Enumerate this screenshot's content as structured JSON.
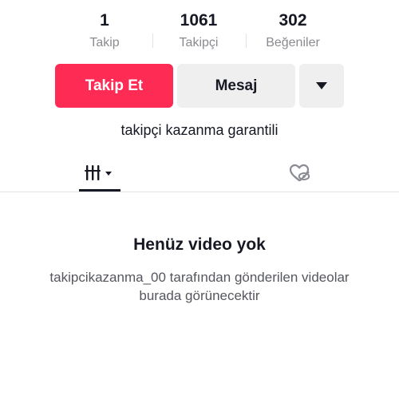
{
  "stats": {
    "following": {
      "value": "1",
      "label": "Takip"
    },
    "followers": {
      "value": "1061",
      "label": "Takipçi"
    },
    "likes": {
      "value": "302",
      "label": "Beğeniler"
    }
  },
  "actions": {
    "follow_label": "Takip Et",
    "message_label": "Mesaj",
    "more_icon": "caret-down-icon"
  },
  "bio": "takipçi kazanma garantili",
  "tabs": [
    {
      "name": "videos",
      "icon": "grid-lines-icon",
      "selected": true
    },
    {
      "name": "liked",
      "icon": "hidden-heart-icon",
      "selected": false
    }
  ],
  "empty_state": {
    "title": "Henüz video yok",
    "description_line1": "takipcikazanma_00 tarafından gönderilen videolar",
    "description_line2": "burada görünecektir"
  },
  "colors": {
    "accent": "#fe2c55",
    "button_secondary": "#efefef",
    "text_primary": "#161823",
    "text_secondary": "#8a8b91"
  }
}
